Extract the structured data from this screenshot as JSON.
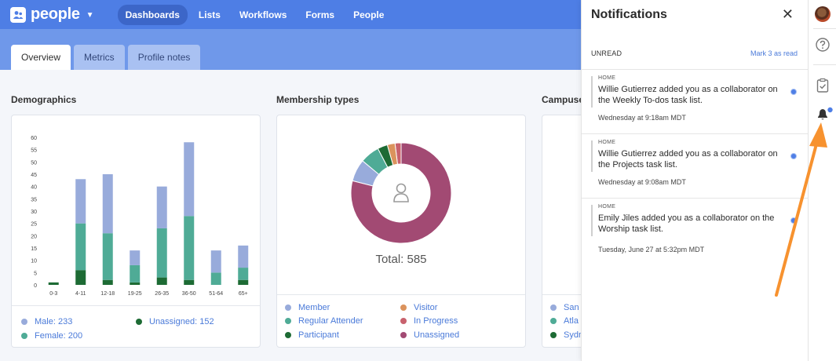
{
  "app": {
    "name": "people"
  },
  "nav": {
    "items": [
      "Dashboards",
      "Lists",
      "Workflows",
      "Forms",
      "People"
    ],
    "active": "Dashboards"
  },
  "tabs": [
    "Overview",
    "Metrics",
    "Profile notes"
  ],
  "sections": {
    "demographics": "Demographics",
    "membership": "Membership types",
    "campuses": "Campuse"
  },
  "demographics": {
    "legend": [
      "Male: 233",
      "Female: 200",
      "Unassigned: 152"
    ],
    "y_ticks": [
      "60",
      "55",
      "50",
      "45",
      "40",
      "35",
      "30",
      "25",
      "20",
      "15",
      "10",
      "5",
      "0"
    ]
  },
  "membership": {
    "total_label": "Total: 585",
    "legend": [
      "Member",
      "Regular Attender",
      "Participant",
      "Visitor",
      "In Progress",
      "Unassigned"
    ]
  },
  "campuses": {
    "legend": [
      "San",
      "Atla",
      "Sydn"
    ]
  },
  "chart_data": [
    {
      "type": "bar",
      "stacked": true,
      "categories": [
        "0-3",
        "4-11",
        "12-18",
        "19-25",
        "26-35",
        "36-50",
        "51-64",
        "65+"
      ],
      "series": [
        {
          "name": "Unassigned",
          "values": [
            1,
            6,
            2,
            1,
            3,
            2,
            0,
            2
          ],
          "color": "#1d6b34"
        },
        {
          "name": "Female",
          "values": [
            0,
            19,
            19,
            7,
            20,
            26,
            5,
            5
          ],
          "color": "#4fab96"
        },
        {
          "name": "Male",
          "values": [
            0,
            18,
            24,
            6,
            17,
            30,
            9,
            9
          ],
          "color": "#98abdb"
        }
      ],
      "ylim": [
        0,
        60
      ],
      "yticks": [
        0,
        5,
        10,
        15,
        20,
        25,
        30,
        35,
        40,
        45,
        50,
        55,
        60
      ],
      "grid": false,
      "legend_position": "bottom"
    },
    {
      "type": "pie",
      "donut": true,
      "labels": [
        "Unassigned",
        "Member",
        "Regular Attender",
        "Participant",
        "Visitor",
        "In Progress"
      ],
      "values": [
        442,
        40,
        35,
        18,
        14,
        11
      ],
      "colors": [
        "#a24a73",
        "#98abdb",
        "#4fab96",
        "#1d6b34",
        "#db935d",
        "#c8616d"
      ],
      "center_label": "Total: 585",
      "legend_position": "bottom"
    }
  ],
  "notifications": {
    "title": "Notifications",
    "unread_label": "UNREAD",
    "mark_read_label": "Mark 3 as read",
    "items": [
      {
        "category": "HOME",
        "message": "Willie Gutierrez added you as a collaborator on the Weekly To-dos task list.",
        "time": "Wednesday at 9:18am MDT"
      },
      {
        "category": "HOME",
        "message": "Willie Gutierrez added you as a collaborator on the Projects task list.",
        "time": "Wednesday at 9:08am MDT"
      },
      {
        "category": "HOME",
        "message": "Emily Jiles added you as a collaborator on the Worship task list.",
        "time": "Tuesday, June 27 at 5:32pm MDT"
      }
    ]
  },
  "rail": {
    "icons": [
      "avatar",
      "help-icon",
      "clipboard-check-icon",
      "bell-icon"
    ]
  },
  "colors": {
    "nav": "#4e7ee5",
    "accent": "#4a7ad9",
    "arrow": "#f7922f"
  }
}
